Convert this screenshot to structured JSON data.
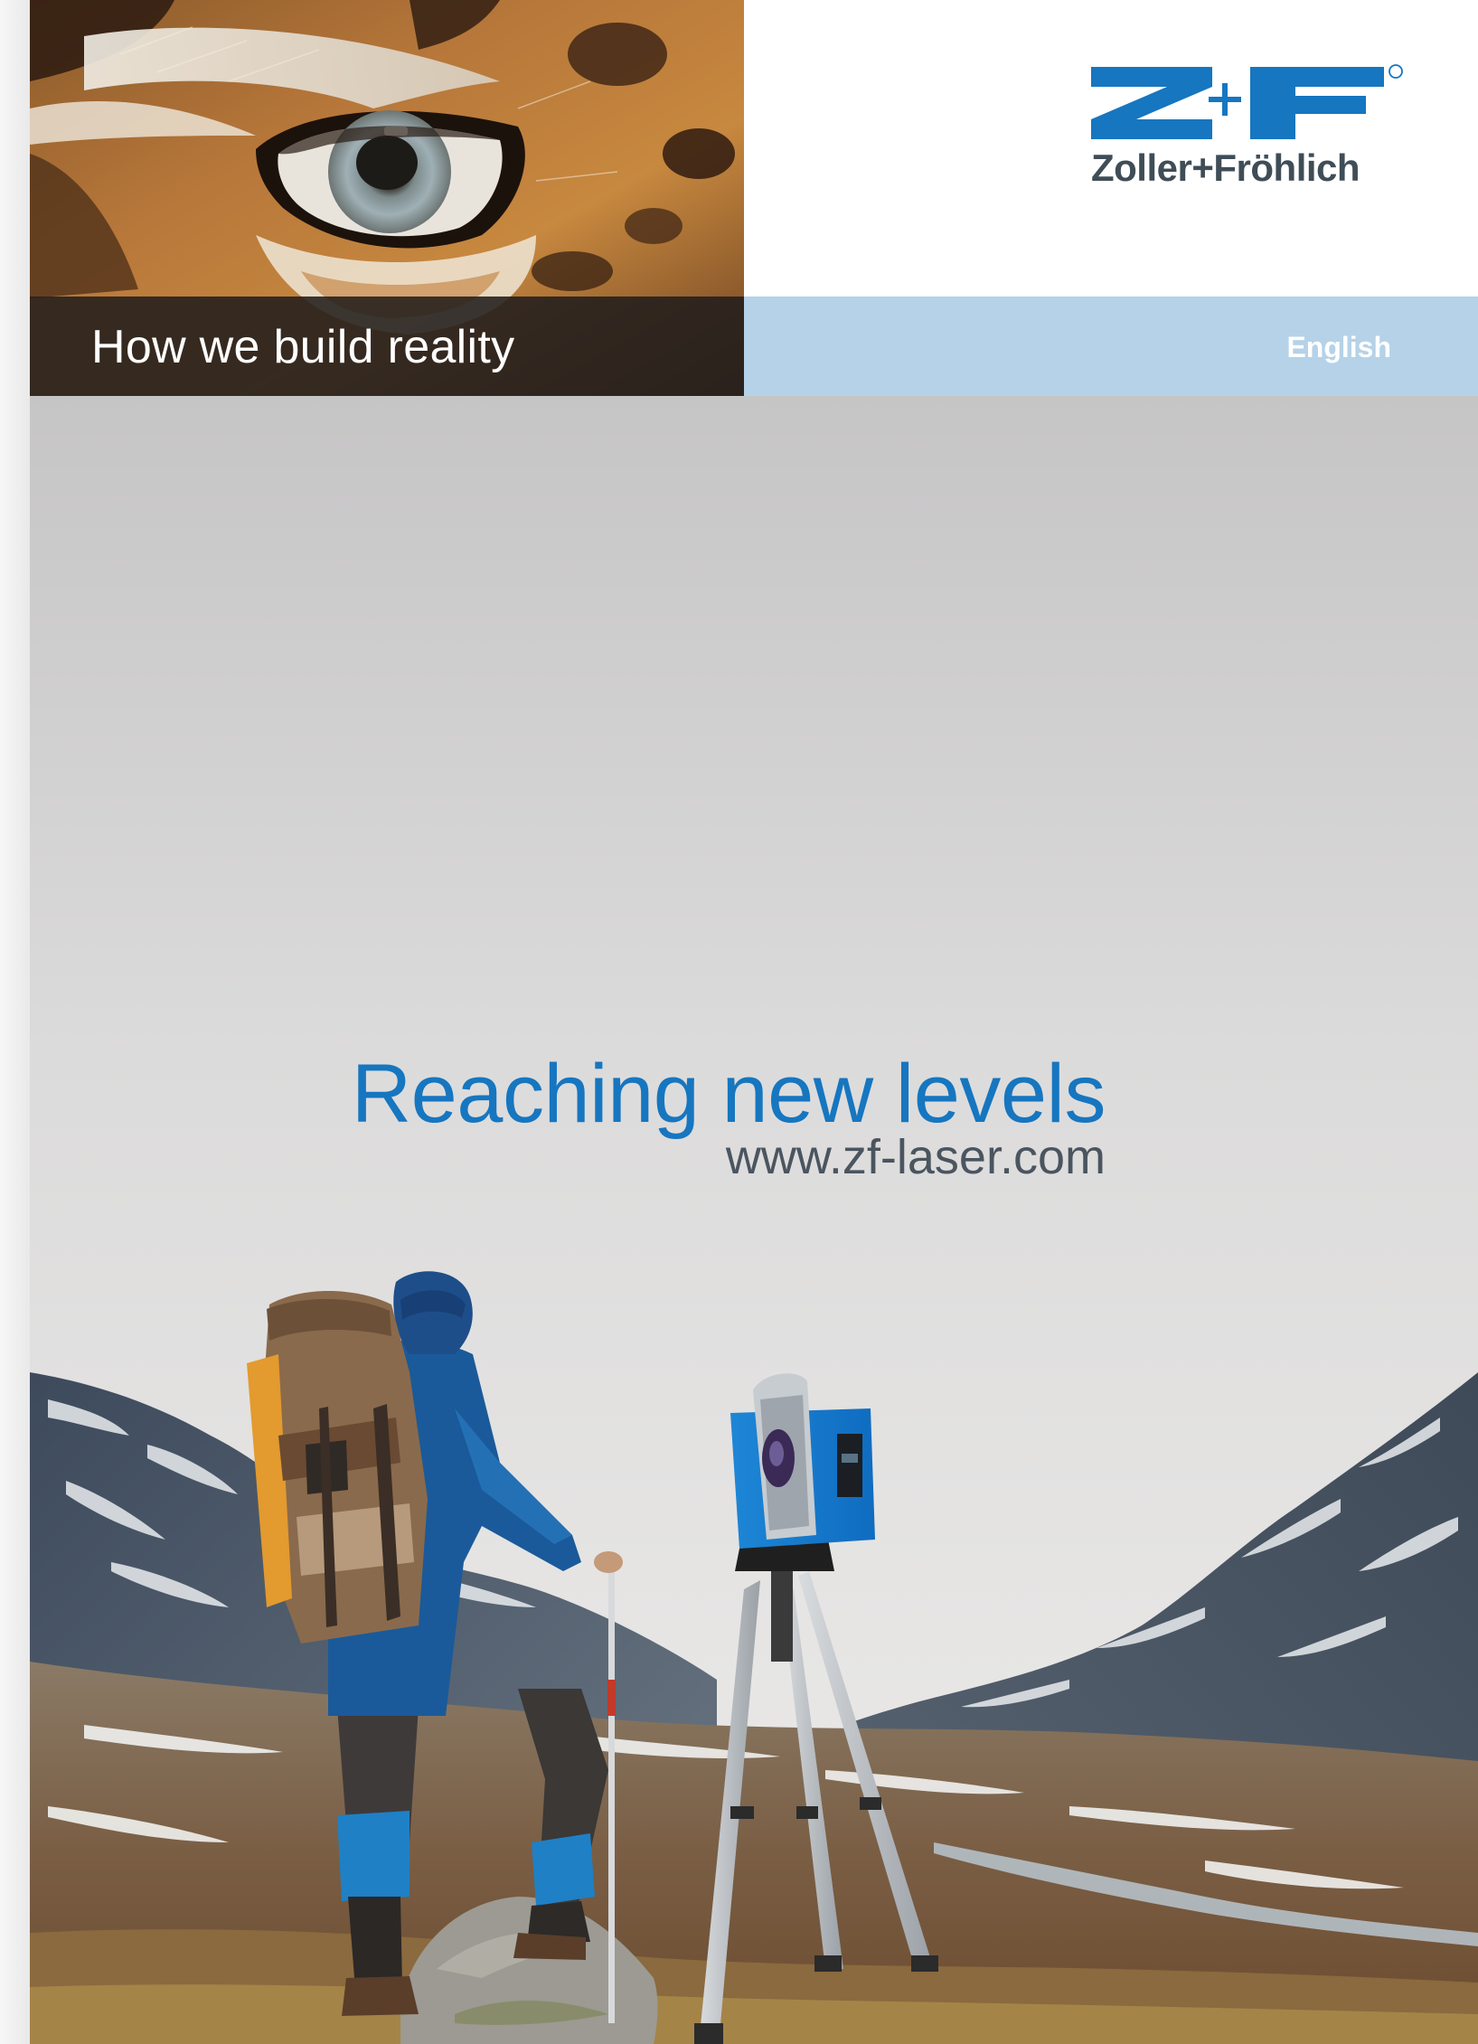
{
  "header": {
    "tagline": "How we build reality",
    "language": "English"
  },
  "logo": {
    "mark": "Z+F",
    "brand_name": "Zoller+Fröhlich",
    "registered_symbol": "®",
    "color": "#1676c0"
  },
  "main": {
    "headline": "Reaching new levels",
    "website": "www.zf-laser.com"
  },
  "colors": {
    "accent_blue": "#1676c0",
    "language_bar": "#b5d2e8",
    "tagline_bar": "#221e1c",
    "text_gray": "#4a5560"
  }
}
